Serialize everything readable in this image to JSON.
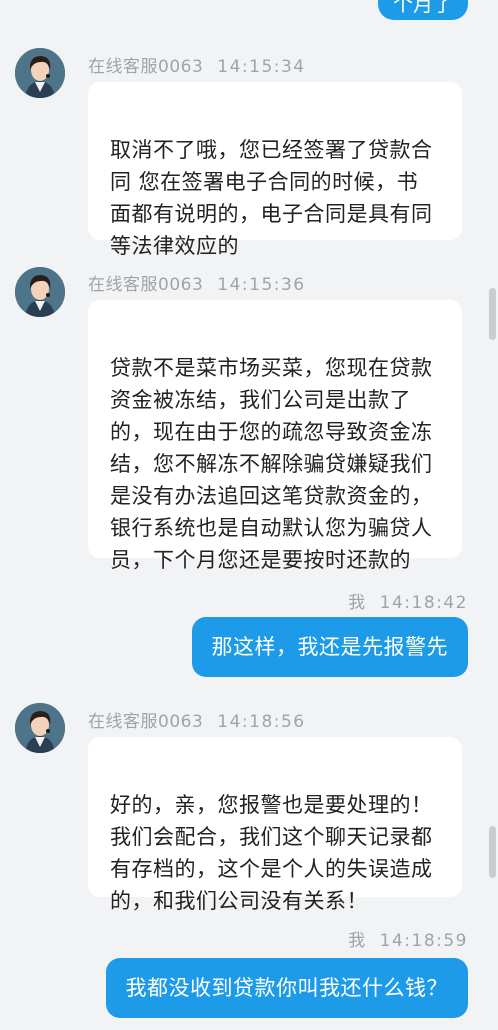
{
  "top_partial": {
    "text": "个月了"
  },
  "messages": [
    {
      "sender": "在线客服0063",
      "time": "14:15:34",
      "text": "取消不了哦，您已经签署了贷款合\n同 您在签署电子合同的时候，书\n面都有说明的，电子合同是具有同\n等法律效应的"
    },
    {
      "sender": "在线客服0063",
      "time": "14:15:36",
      "text": "贷款不是菜市场买菜，您现在贷款\n资金被冻结，我们公司是出款了\n的，现在由于您的疏忽导致资金冻\n结，您不解冻不解除骗贷嫌疑我们\n是没有办法追回这笔贷款资金的，\n银行系统也是自动默认您为骗贷人\n员，下个月您还是要按时还款的"
    },
    {
      "sender": "我",
      "time": "14:18:42",
      "text": "那这样，我还是先报警先"
    },
    {
      "sender": "在线客服0063",
      "time": "14:18:56",
      "text": "好的，亲，您报警也是要处理的！\n我们会配合，我们这个聊天记录都\n有存档的，这个是个人的失误造成\n的，和我们公司没有关系！"
    },
    {
      "sender": "我",
      "time": "14:18:59",
      "text": "我都没收到贷款你叫我还什么钱？"
    }
  ],
  "colors": {
    "outgoing": "#1e9be8",
    "incoming": "#ffffff",
    "background": "#f2f3f5"
  },
  "icons": {
    "avatar": "agent-avatar-icon"
  }
}
